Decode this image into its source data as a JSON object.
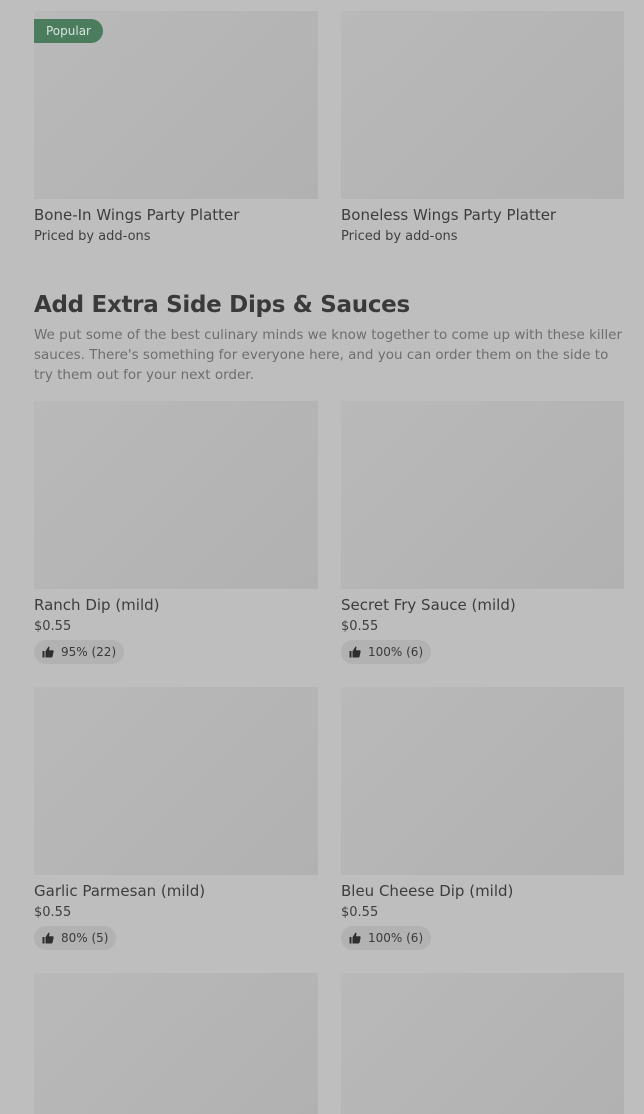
{
  "top_items": [
    {
      "name": "Bone-In Wings Party Platter",
      "sub": "Priced by add-ons",
      "badge": "Popular"
    },
    {
      "name": "Boneless Wings Party Platter",
      "sub": "Priced by add-ons",
      "badge": ""
    }
  ],
  "section": {
    "title": "Add Extra Side Dips & Sauces",
    "description": "We put some of the best culinary minds we know together to come up with these killer sauces. There's something for everyone here, and you can order them on the side to try them out for your next order."
  },
  "items": [
    {
      "name": "Ranch Dip (mild)",
      "price": "$0.55",
      "rating": "95% (22)"
    },
    {
      "name": "Secret Fry Sauce (mild)",
      "price": "$0.55",
      "rating": "100% (6)"
    },
    {
      "name": "Garlic Parmesan (mild)",
      "price": "$0.55",
      "rating": "80% (5)"
    },
    {
      "name": "Bleu Cheese Dip (mild)",
      "price": "$0.55",
      "rating": "100% (6)"
    }
  ],
  "icons": {
    "rating": "thumbs-up-icon"
  },
  "colors": {
    "badge_bg": "#4a7c5d",
    "page_bg": "#bebebe"
  }
}
